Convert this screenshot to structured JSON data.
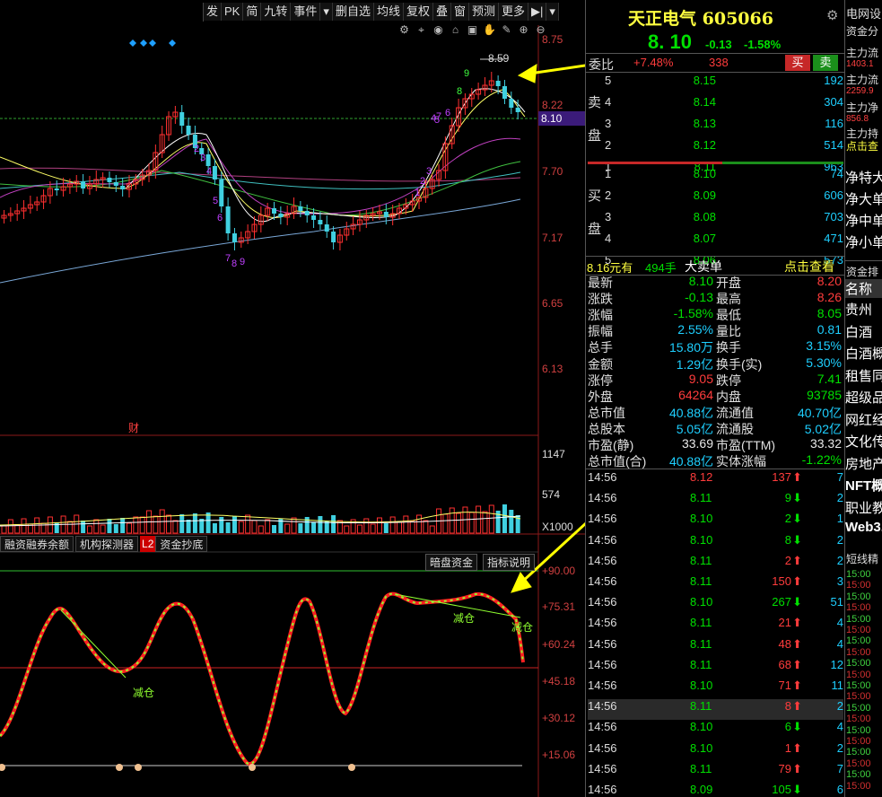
{
  "toolbar": {
    "items": [
      "发",
      "PK",
      "简",
      "九转",
      "事件",
      "删自选",
      "均线",
      "复权",
      "叠",
      "窗",
      "预测",
      "更多"
    ]
  },
  "chart": {
    "high_label": "8.59",
    "price_axis": [
      "8.75",
      "8.22",
      "7.70",
      "7.17",
      "6.65",
      "6.13"
    ],
    "current_price_tag": "8.10",
    "volume_axis": [
      "1147",
      "574",
      "X1000"
    ],
    "indicator_axis": [
      "+90.00",
      "+75.31",
      "+60.24",
      "+45.18",
      "+30.12",
      "+15.06"
    ],
    "annotation_cai": "财",
    "indicator_labels": [
      "减仓",
      "减仓",
      "减仓"
    ],
    "nine_turn_numbers": [
      "9",
      "8",
      "6",
      "7",
      "5",
      "4",
      "2",
      "3",
      "1",
      "7",
      "8",
      "9",
      "6",
      "5",
      "3",
      "4",
      "2"
    ]
  },
  "tabs": [
    {
      "label": "融资融券余额"
    },
    {
      "label": "机构探测器"
    },
    {
      "tag": "L2",
      "label": "资金抄底"
    }
  ],
  "indicator_buttons": [
    "暗盘资金",
    "指标说明"
  ],
  "stock": {
    "name": "天正电气",
    "code": "605066",
    "price": "8. 10",
    "change": "-0.13",
    "change_pct": "-1.58%",
    "webi_label": "委比",
    "webi_value": "+7.48%",
    "webi_diff": "338",
    "sell_btn": "买",
    "buy_btn": "卖"
  },
  "orderbook": {
    "sell_label": [
      "卖",
      "盘"
    ],
    "buy_label": [
      "买",
      "盘"
    ],
    "sells": [
      {
        "lvl": "5",
        "price": "8.15",
        "vol": "192"
      },
      {
        "lvl": "4",
        "price": "8.14",
        "vol": "304"
      },
      {
        "lvl": "3",
        "price": "8.13",
        "vol": "116"
      },
      {
        "lvl": "2",
        "price": "8.12",
        "vol": "514"
      },
      {
        "lvl": "1",
        "price": "8.11",
        "vol": "963"
      }
    ],
    "buys": [
      {
        "lvl": "1",
        "price": "8.10",
        "vol": "74"
      },
      {
        "lvl": "2",
        "price": "8.09",
        "vol": "606"
      },
      {
        "lvl": "3",
        "price": "8.08",
        "vol": "703"
      },
      {
        "lvl": "4",
        "price": "8.07",
        "vol": "471"
      },
      {
        "lvl": "5",
        "price": "8.06",
        "vol": "573"
      }
    ],
    "big_order": {
      "price": "8.16元有",
      "qty": "494手",
      "label": "大卖单",
      "link": "点击查看"
    }
  },
  "stats": [
    {
      "l1": "最新",
      "v1": "8.10",
      "c1": "green",
      "l2": "开盘",
      "v2": "8.20",
      "c2": "red"
    },
    {
      "l1": "涨跌",
      "v1": "-0.13",
      "c1": "green",
      "l2": "最高",
      "v2": "8.26",
      "c2": "red"
    },
    {
      "l1": "涨幅",
      "v1": "-1.58%",
      "c1": "green",
      "l2": "最低",
      "v2": "8.05",
      "c2": "green"
    },
    {
      "l1": "振幅",
      "v1": "2.55%",
      "c1": "cyan",
      "l2": "量比",
      "v2": "0.81",
      "c2": "cyan"
    },
    {
      "l1": "总手",
      "v1": "15.80万",
      "c1": "cyan",
      "l2": "换手",
      "v2": "3.15%",
      "c2": "cyan"
    },
    {
      "l1": "金额",
      "v1": "1.29亿",
      "c1": "cyan",
      "l2": "换手(实)",
      "v2": "5.30%",
      "c2": "cyan"
    },
    {
      "l1": "涨停",
      "v1": "9.05",
      "c1": "red",
      "l2": "跌停",
      "v2": "7.41",
      "c2": "green"
    },
    {
      "l1": "外盘",
      "v1": "64264",
      "c1": "red",
      "l2": "内盘",
      "v2": "93785",
      "c2": "green"
    },
    {
      "l1": "总市值",
      "v1": "40.88亿",
      "c1": "cyan",
      "l2": "流通值",
      "v2": "40.70亿",
      "c2": "cyan"
    },
    {
      "l1": "总股本",
      "v1": "5.05亿",
      "c1": "cyan",
      "l2": "流通股",
      "v2": "5.02亿",
      "c2": "cyan"
    },
    {
      "l1": "市盈(静)",
      "v1": "33.69",
      "c1": "white",
      "l2": "市盈(TTM)",
      "v2": "33.32",
      "c2": "white"
    },
    {
      "l1": "总市值(合)",
      "v1": "40.88亿",
      "c1": "cyan",
      "l2": "实体涨幅",
      "v2": "-1.22%",
      "c2": "green"
    }
  ],
  "ticks": [
    {
      "t": "14:56",
      "p": "8.12",
      "pc": "red",
      "v": "137",
      "dir": "up",
      "n": "7"
    },
    {
      "t": "14:56",
      "p": "8.11",
      "pc": "green",
      "v": "9",
      "dir": "down",
      "n": "2"
    },
    {
      "t": "14:56",
      "p": "8.10",
      "pc": "green",
      "v": "2",
      "dir": "down",
      "n": "1"
    },
    {
      "t": "14:56",
      "p": "8.10",
      "pc": "green",
      "v": "8",
      "dir": "down",
      "n": "2"
    },
    {
      "t": "14:56",
      "p": "8.11",
      "pc": "green",
      "v": "2",
      "dir": "up",
      "n": "2"
    },
    {
      "t": "14:56",
      "p": "8.11",
      "pc": "green",
      "v": "150",
      "dir": "up",
      "n": "3"
    },
    {
      "t": "14:56",
      "p": "8.10",
      "pc": "green",
      "v": "267",
      "dir": "down",
      "n": "51"
    },
    {
      "t": "14:56",
      "p": "8.11",
      "pc": "green",
      "v": "21",
      "dir": "up",
      "n": "4"
    },
    {
      "t": "14:56",
      "p": "8.11",
      "pc": "green",
      "v": "48",
      "dir": "up",
      "n": "4"
    },
    {
      "t": "14:56",
      "p": "8.11",
      "pc": "green",
      "v": "68",
      "dir": "up",
      "n": "12"
    },
    {
      "t": "14:56",
      "p": "8.10",
      "pc": "green",
      "v": "71",
      "dir": "up",
      "n": "11"
    },
    {
      "t": "14:56",
      "p": "8.11",
      "pc": "green",
      "v": "8",
      "dir": "up",
      "n": "2"
    },
    {
      "t": "14:56",
      "p": "8.10",
      "pc": "green",
      "v": "6",
      "dir": "down",
      "n": "4"
    },
    {
      "t": "14:56",
      "p": "8.10",
      "pc": "green",
      "v": "1",
      "dir": "up",
      "n": "2"
    },
    {
      "t": "14:56",
      "p": "8.11",
      "pc": "green",
      "v": "79",
      "dir": "up",
      "n": "7"
    },
    {
      "t": "14:56",
      "p": "8.09",
      "pc": "green",
      "v": "105",
      "dir": "down",
      "n": "6"
    }
  ],
  "far_panel": {
    "header": "电网设",
    "sub": "资金分",
    "flows": [
      {
        "label": "主力流",
        "value": "1403.1"
      },
      {
        "label": "主力流",
        "value": "2259.9"
      },
      {
        "label": "主力净",
        "value": "856.8"
      },
      {
        "label": "主力持",
        "value": ""
      }
    ],
    "click": "点击查",
    "net": [
      "净特大",
      "净大单",
      "净中单",
      "净小单"
    ],
    "rank_header": "资金排",
    "rank_col": "名称",
    "sectors": [
      "贵州",
      "白酒",
      "白酒概",
      "租售同",
      "超级品",
      "网红经",
      "文化传",
      "房地产",
      "NFT概",
      "职业教",
      "Web3."
    ],
    "bottom_header": "短线精",
    "times": [
      "15:00",
      "15:00",
      "15:00",
      "15:00",
      "15:00",
      "15:00",
      "15:00",
      "15:00",
      "15:00",
      "15:00",
      "15:00",
      "15:00",
      "15:00",
      "15:00",
      "15:00",
      "15:00",
      "15:00",
      "15:00",
      "15:00",
      "15:00"
    ]
  }
}
